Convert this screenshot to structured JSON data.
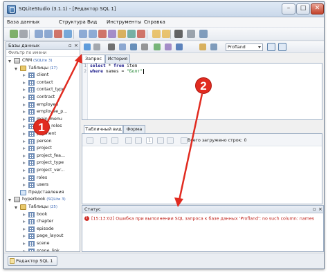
{
  "window": {
    "title": "SQLiteStudio (3.1.1) - [Редактор SQL 1]"
  },
  "menu": [
    "База данных",
    "Структура",
    "Вид",
    "Инструменты",
    "Справка"
  ],
  "toolbar": {
    "db_select": "Profland",
    "icons": [
      "connect-icon",
      "disconnect-icon",
      "add-db-icon",
      "edit-db-icon",
      "delete-db-icon",
      "refresh-icon",
      "new-table-icon",
      "edit-table-icon",
      "delete-table-icon",
      "new-index-icon",
      "new-trigger-icon",
      "new-view-icon",
      "delete-icon",
      "sql-editor-icon",
      "open-sql-icon",
      "fx-icon",
      "settings-icon",
      "window-icon"
    ]
  },
  "left_panel": {
    "title": "Базы данных",
    "filter_placeholder": "Фильтр по имени",
    "tree": [
      {
        "label": "CRM",
        "badge": "(SQLite 3)",
        "level": 0,
        "icon": "db",
        "exp": "open"
      },
      {
        "label": "Таблицы",
        "badge": "(17)",
        "level": 1,
        "icon": "folder",
        "exp": "open"
      },
      {
        "label": "client",
        "level": 2,
        "icon": "table",
        "exp": "closed"
      },
      {
        "label": "contact",
        "level": 2,
        "icon": "table",
        "exp": "closed"
      },
      {
        "label": "contact_type",
        "level": 2,
        "icon": "table",
        "exp": "closed"
      },
      {
        "label": "contract",
        "level": 2,
        "icon": "table",
        "exp": "closed"
      },
      {
        "label": "employee",
        "level": 2,
        "icon": "table",
        "exp": "closed"
      },
      {
        "label": "employee_p...",
        "level": 2,
        "icon": "table",
        "exp": "closed"
      },
      {
        "label": "main_menu",
        "level": 2,
        "icon": "table",
        "exp": "closed"
      },
      {
        "label": "menu_roles",
        "level": 2,
        "icon": "table",
        "exp": "closed"
      },
      {
        "label": "payment",
        "level": 2,
        "icon": "table",
        "exp": "closed"
      },
      {
        "label": "person",
        "level": 2,
        "icon": "table",
        "exp": "closed"
      },
      {
        "label": "project",
        "level": 2,
        "icon": "table",
        "exp": "closed"
      },
      {
        "label": "project_fea...",
        "level": 2,
        "icon": "table",
        "exp": "closed"
      },
      {
        "label": "project_type",
        "level": 2,
        "icon": "table",
        "exp": "closed"
      },
      {
        "label": "project_ver...",
        "level": 2,
        "icon": "table",
        "exp": "closed"
      },
      {
        "label": "roles",
        "level": 2,
        "icon": "table",
        "exp": "closed"
      },
      {
        "label": "users",
        "level": 2,
        "icon": "table",
        "exp": "closed"
      },
      {
        "label": "Представления",
        "level": 1,
        "icon": "view",
        "exp": "none"
      },
      {
        "label": "hyperbook",
        "badge": "(SQLite 3)",
        "level": 0,
        "icon": "db",
        "exp": "open"
      },
      {
        "label": "Таблицы",
        "badge": "(25)",
        "level": 1,
        "icon": "folder",
        "exp": "open"
      },
      {
        "label": "book",
        "level": 2,
        "icon": "table",
        "exp": "closed"
      },
      {
        "label": "chapter",
        "level": 2,
        "icon": "table",
        "exp": "closed"
      },
      {
        "label": "episode",
        "level": 2,
        "icon": "table",
        "exp": "closed"
      },
      {
        "label": "page_layout",
        "level": 2,
        "icon": "table",
        "exp": "closed"
      },
      {
        "label": "scene",
        "level": 2,
        "icon": "table",
        "exp": "closed"
      },
      {
        "label": "scene_link",
        "level": 2,
        "icon": "table",
        "exp": "closed"
      }
    ]
  },
  "editor": {
    "tabs": [
      "Запрос",
      "История"
    ],
    "line_numbers": [
      "1",
      "2"
    ],
    "line1": {
      "kw1": "select",
      "rest1": " * ",
      "kw2": "from",
      "rest2": " item"
    },
    "line2": {
      "kw1": "where",
      "rest1": " names = ",
      "str": "\"Болт\""
    }
  },
  "results": {
    "tabs": [
      "Табличный вид",
      "Форма"
    ],
    "page_number": "1",
    "rows_loaded": "Всего загружено строк: 0"
  },
  "status": {
    "title": "Статус",
    "message": "[15:13:02]  Ошибка при выполнении SQL запроса к базе данных 'Profland': no such column: names"
  },
  "taskbar": {
    "item": "Редактор SQL 1"
  },
  "callouts": {
    "one": "1",
    "two": "2"
  },
  "colors": {
    "callout": "#e12b20",
    "error": "#c0231c",
    "accent": "#3a67b6"
  }
}
